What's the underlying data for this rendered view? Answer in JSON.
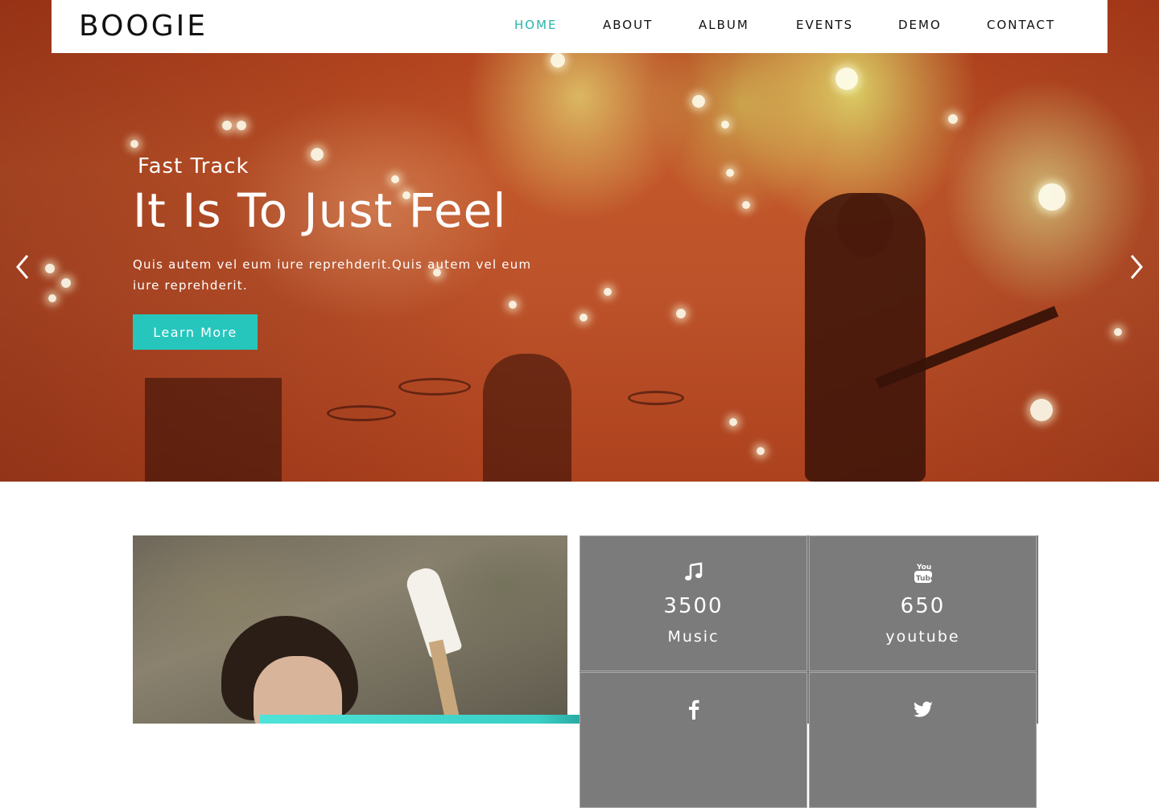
{
  "brand": {
    "logo": "BOOGIE",
    "accent_color": "#26c6bd"
  },
  "nav": {
    "items": [
      {
        "label": "HOME",
        "active": true
      },
      {
        "label": "ABOUT",
        "active": false
      },
      {
        "label": "ALBUM",
        "active": false
      },
      {
        "label": "EVENTS",
        "active": false
      },
      {
        "label": "DEMO",
        "active": false
      },
      {
        "label": "CONTACT",
        "active": false
      }
    ]
  },
  "hero": {
    "subtitle": "Fast Track",
    "title": "It Is To Just Feel",
    "description": "Quis autem vel eum iure reprehderit.Quis autem vel eum iure reprehderit.",
    "button_label": "Learn More",
    "prev_icon": "chevron-left-icon",
    "next_icon": "chevron-right-icon"
  },
  "stats": [
    {
      "icon": "music-note-icon",
      "value": "3500",
      "label": "Music"
    },
    {
      "icon": "youtube-icon",
      "value": "650",
      "label": "youtube"
    },
    {
      "icon": "facebook-icon",
      "value": "",
      "label": ""
    },
    {
      "icon": "twitter-icon",
      "value": "",
      "label": ""
    }
  ]
}
